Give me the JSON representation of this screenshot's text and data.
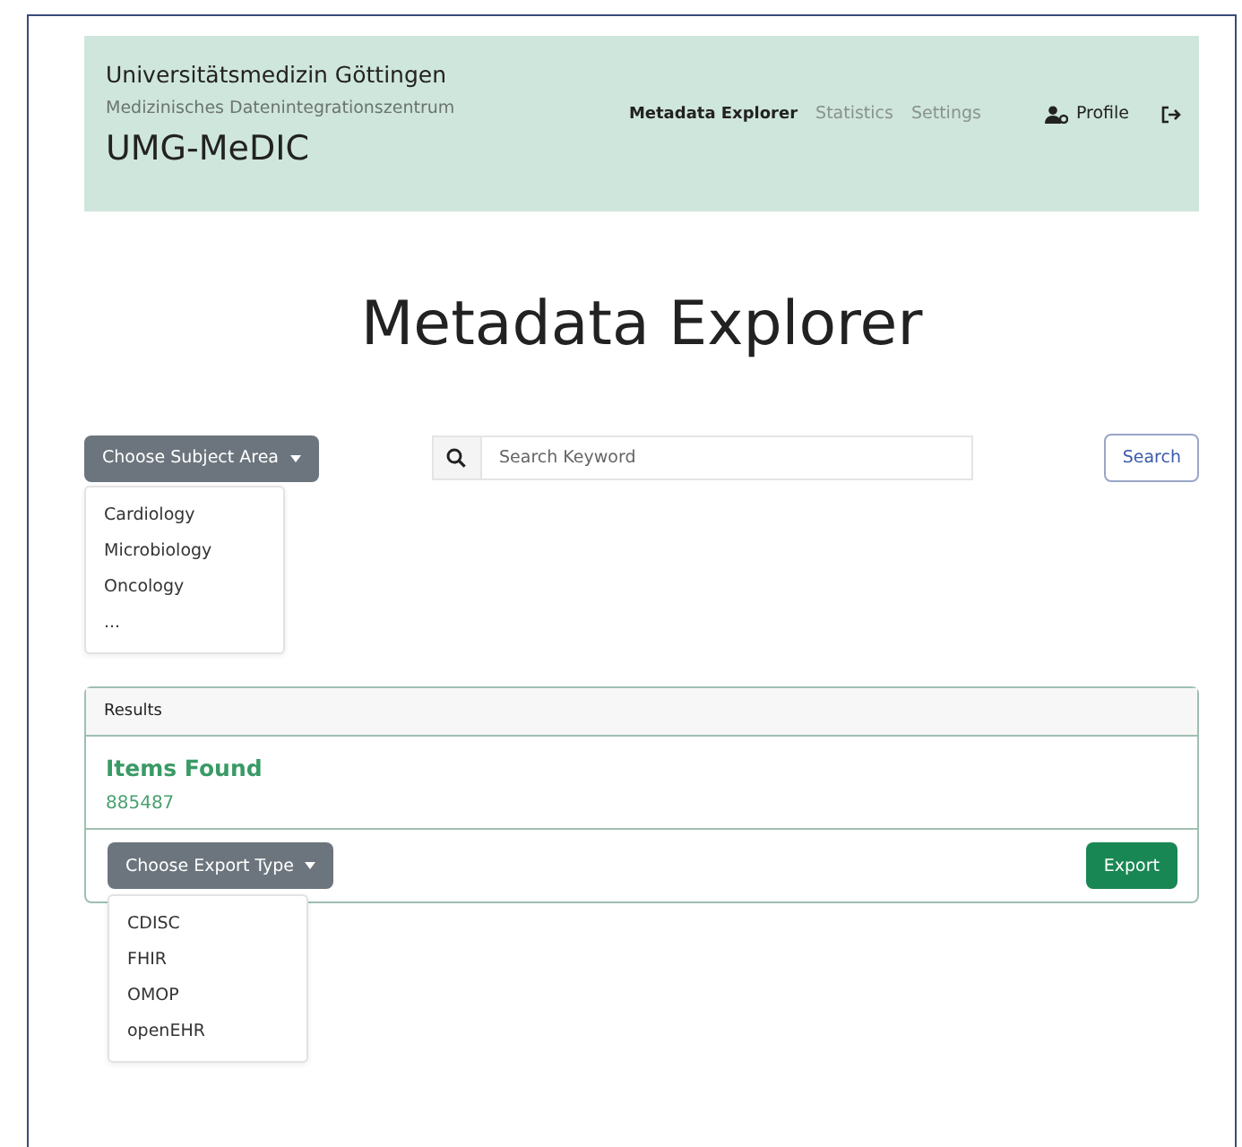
{
  "header": {
    "organization": "Universitätsmedizin Göttingen",
    "subtitle": "Medizinisches Datenintegrationszentrum",
    "brand": "UMG-MeDIC",
    "nav": [
      {
        "label": "Metadata Explorer",
        "selected": true
      },
      {
        "label": "Statistics",
        "selected": false
      },
      {
        "label": "Settings",
        "selected": false
      }
    ],
    "profile": "Profile"
  },
  "title": "Metadata Explorer",
  "subject_dropdown": {
    "label": "Choose Subject Area",
    "expanded": true,
    "options": [
      "Cardiology",
      "Microbiology",
      "Oncology",
      "..."
    ]
  },
  "search": {
    "placeholder": "Search Keyword",
    "button": "Search"
  },
  "results": {
    "header": "Results",
    "heading": "Items Found",
    "count": "885487",
    "export_dropdown": {
      "label": "Choose Export Type",
      "expanded": true,
      "options": [
        "CDISC",
        "FHIR",
        "OMOP",
        "openEHR"
      ]
    },
    "export_button": "Export"
  }
}
